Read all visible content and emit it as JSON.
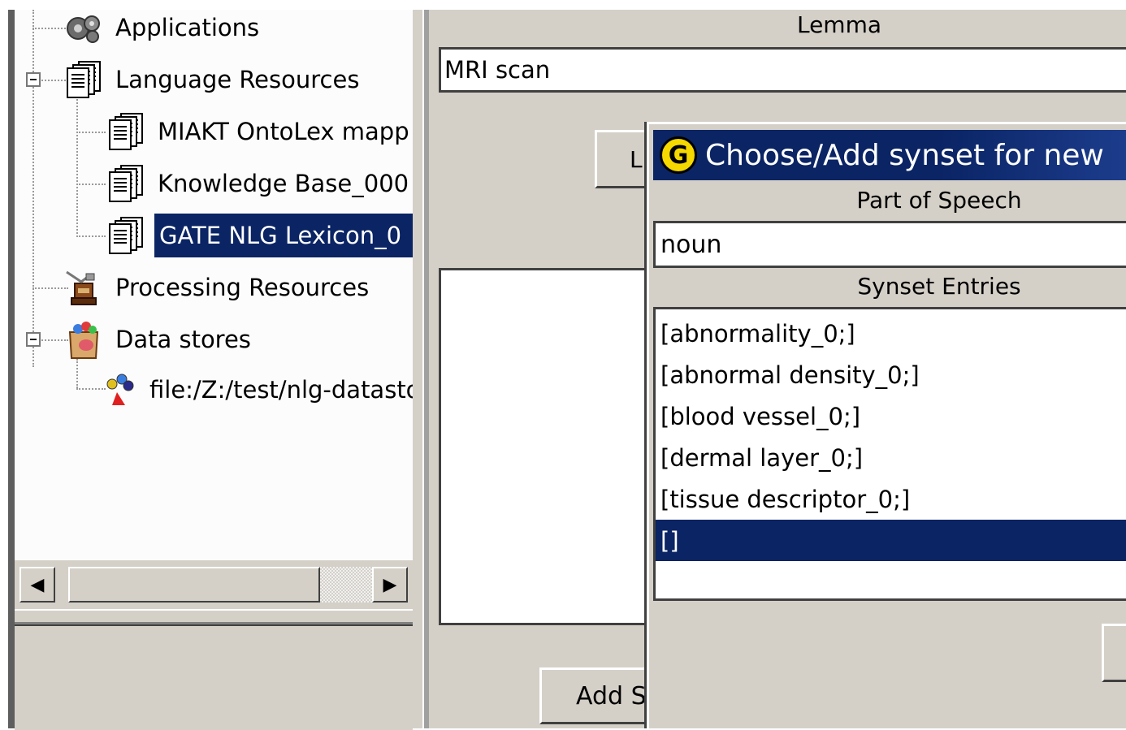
{
  "tree": {
    "items": [
      {
        "label": "Applications",
        "icon": "applications-icon",
        "selected": false
      },
      {
        "label": "Language Resources",
        "icon": "language-resources-icon",
        "selected": false
      },
      {
        "label": "MIAKT OntoLex mapp",
        "icon": "document-stack-icon",
        "selected": false
      },
      {
        "label": "Knowledge Base_000",
        "icon": "document-stack-icon",
        "selected": false
      },
      {
        "label": "GATE NLG Lexicon_0",
        "icon": "document-stack-icon",
        "selected": true
      },
      {
        "label": "Processing Resources",
        "icon": "processing-resources-icon",
        "selected": false
      },
      {
        "label": "Data stores",
        "icon": "data-stores-icon",
        "selected": false
      },
      {
        "label": "file:/Z:/test/nlg-datastor",
        "icon": "datastore-file-icon",
        "selected": false
      }
    ]
  },
  "scrollbar": {
    "left_glyph": "◀",
    "right_glyph": "▶"
  },
  "editor": {
    "lemma_label": "Lemma",
    "lemma_value": "MRI scan",
    "lookup_button_label": "L",
    "add_button_label": "Add S"
  },
  "dialog": {
    "title": "Choose/Add synset for new",
    "icon_letter": "G",
    "pos_label": "Part of Speech",
    "pos_value": "noun",
    "synset_label": "Synset Entries",
    "synsets": [
      "[abnormality_0;]",
      "[abnormal density_0;]",
      "[blood vessel_0;]",
      "[dermal layer_0;]",
      "[tissue descriptor_0;]",
      "[]"
    ],
    "selected_synset_index": 5
  },
  "colors": {
    "selection": "#0a2464",
    "panel": "#d4d0c8",
    "dialog_icon": "#f4d800"
  }
}
